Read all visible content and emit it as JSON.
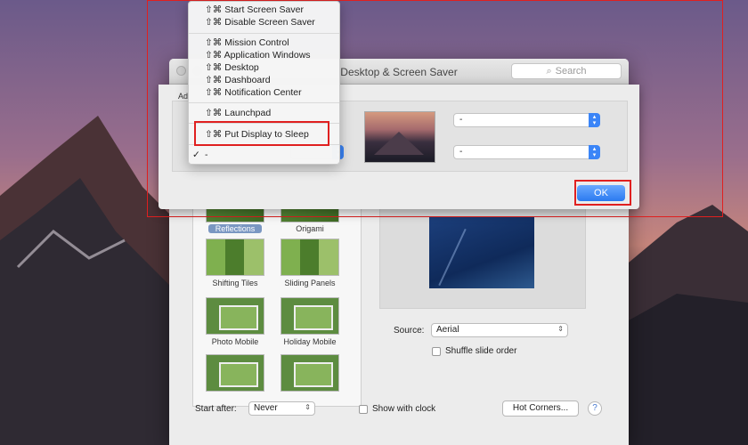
{
  "window": {
    "title": "Desktop & Screen Saver",
    "search_placeholder": "Search",
    "tab_stub": "Ad"
  },
  "screen_savers": [
    {
      "label": "Reflections",
      "selected": true
    },
    {
      "label": "Origami"
    },
    {
      "label": "Shifting Tiles"
    },
    {
      "label": "Sliding Panels"
    },
    {
      "label": "Photo Mobile"
    },
    {
      "label": "Holiday Mobile"
    }
  ],
  "options": {
    "source_label": "Source:",
    "source_value": "Aerial",
    "shuffle_label": "Shuffle slide order",
    "start_after_label": "Start after:",
    "start_after_value": "Never",
    "show_clock_label": "Show with clock",
    "hot_corners_button": "Hot Corners...",
    "help_glyph": "?"
  },
  "hot_corners_sheet": {
    "top_left": "",
    "top_right": "-",
    "bottom_left": "",
    "bottom_right": "-",
    "ok_label": "OK"
  },
  "menu": {
    "items": [
      {
        "shortcut": "⇧⌘",
        "label": "Start Screen Saver"
      },
      {
        "shortcut": "⇧⌘",
        "label": "Disable Screen Saver"
      },
      {
        "shortcut": "⇧⌘",
        "label": "Mission Control"
      },
      {
        "shortcut": "⇧⌘",
        "label": "Application Windows"
      },
      {
        "shortcut": "⇧⌘",
        "label": "Desktop"
      },
      {
        "shortcut": "⇧⌘",
        "label": "Dashboard"
      },
      {
        "shortcut": "⇧⌘",
        "label": "Notification Center"
      },
      {
        "shortcut": "⇧⌘",
        "label": "Launchpad"
      },
      {
        "shortcut": "⇧⌘",
        "label": "Put Display to Sleep"
      },
      {
        "shortcut": "",
        "label": "-",
        "checked": true
      }
    ],
    "checkmark": "✓",
    "highlighted_item": "Put Display to Sleep"
  },
  "colors": {
    "annotation_red": "#e02020",
    "accent_blue": "#2b7af0"
  }
}
